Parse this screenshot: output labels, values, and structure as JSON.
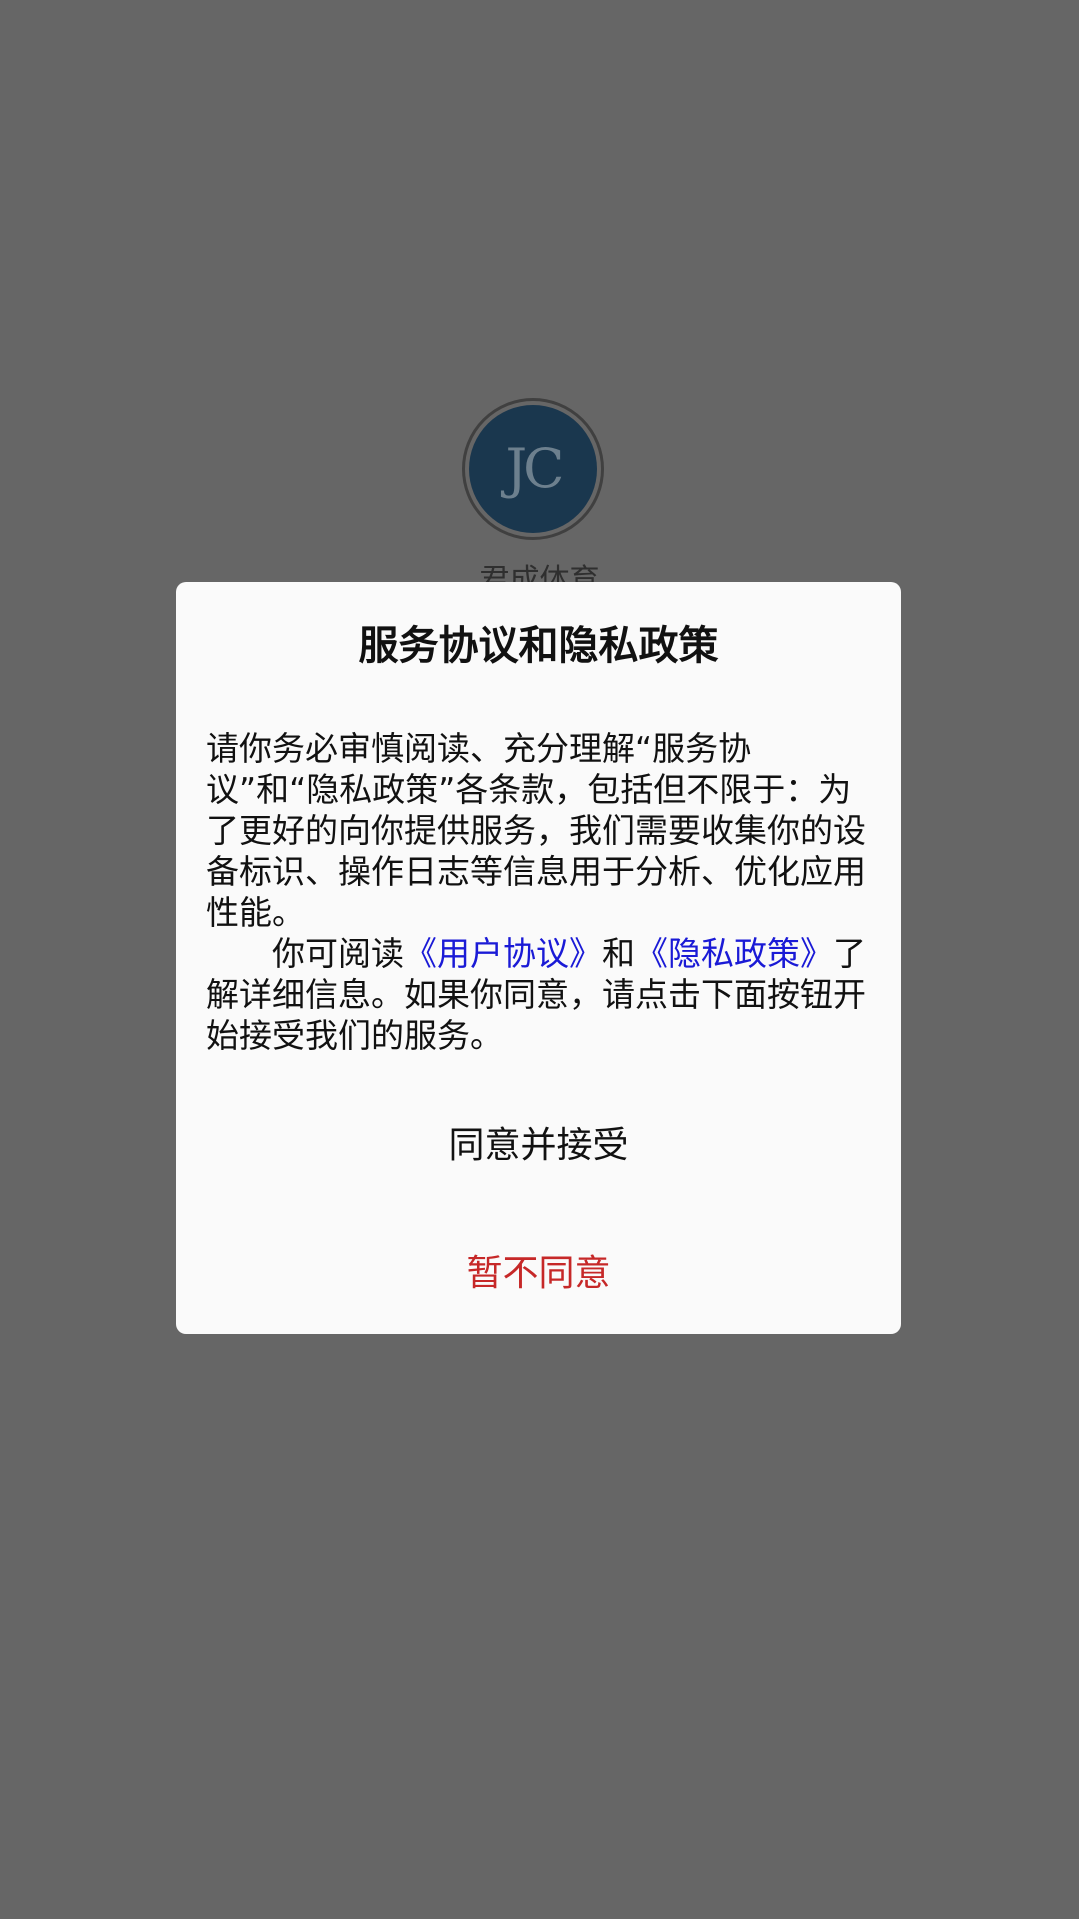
{
  "splash": {
    "logo_text": "JC",
    "app_name": "君成体育"
  },
  "dialog": {
    "title": "服务协议和隐私政策",
    "paragraph1": "请你务必审慎阅读、充分理解“服务协议”和“隐私政策”各条款，包括但不限于：为了更好的向你提供服务，我们需要收集你的设备标识、操作日志等信息用于分析、优化应用性能。",
    "paragraph2_prefix": "你可阅读",
    "user_agreement_link": "《用户协议》",
    "paragraph2_and": "和",
    "privacy_policy_link": "《隐私政策》",
    "paragraph2_suffix": "了解详细信息。如果你同意，请点击下面按钮开始接受我们的服务。",
    "agree_label": "同意并接受",
    "decline_label": "暂不同意"
  },
  "colors": {
    "scrim": "#666666",
    "dialog_background": "#fafafa",
    "link": "#1a1ad6",
    "decline": "#c62828",
    "logo_disc": "#0d2f4a"
  }
}
